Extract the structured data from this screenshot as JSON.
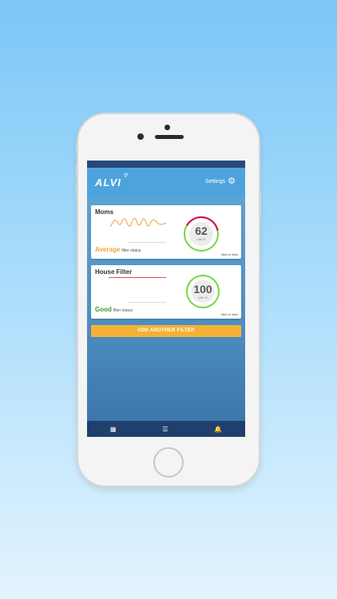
{
  "app": {
    "logo_text": "ALVI"
  },
  "header": {
    "settings_label": "Settings",
    "settings_icon": "gear-icon"
  },
  "filters": [
    {
      "name": "Moms",
      "life_percent": "62",
      "life_label": "Life %",
      "status_word": "Average",
      "status_color": "#f0a640",
      "status_suffix": "filter status",
      "click_label": "click to view"
    },
    {
      "name": "House Filter",
      "life_percent": "100",
      "life_label": "Life %",
      "status_word": "Good",
      "status_color": "#3e9a2e",
      "status_suffix": "filter status",
      "click_label": "click to view"
    }
  ],
  "add_button_label": "ADD ANOTHER FILTER",
  "tabs": [
    {
      "icon": "dashboard-icon",
      "glyph": "▦"
    },
    {
      "icon": "list-icon",
      "glyph": "☰"
    },
    {
      "icon": "bell-icon",
      "glyph": "🔔"
    }
  ],
  "colors": {
    "accent": "#4ea3dc",
    "nav": "#1f3f6c",
    "button": "#f4b136",
    "gauge_red": "#d5154d",
    "gauge_green": "#74d843"
  }
}
